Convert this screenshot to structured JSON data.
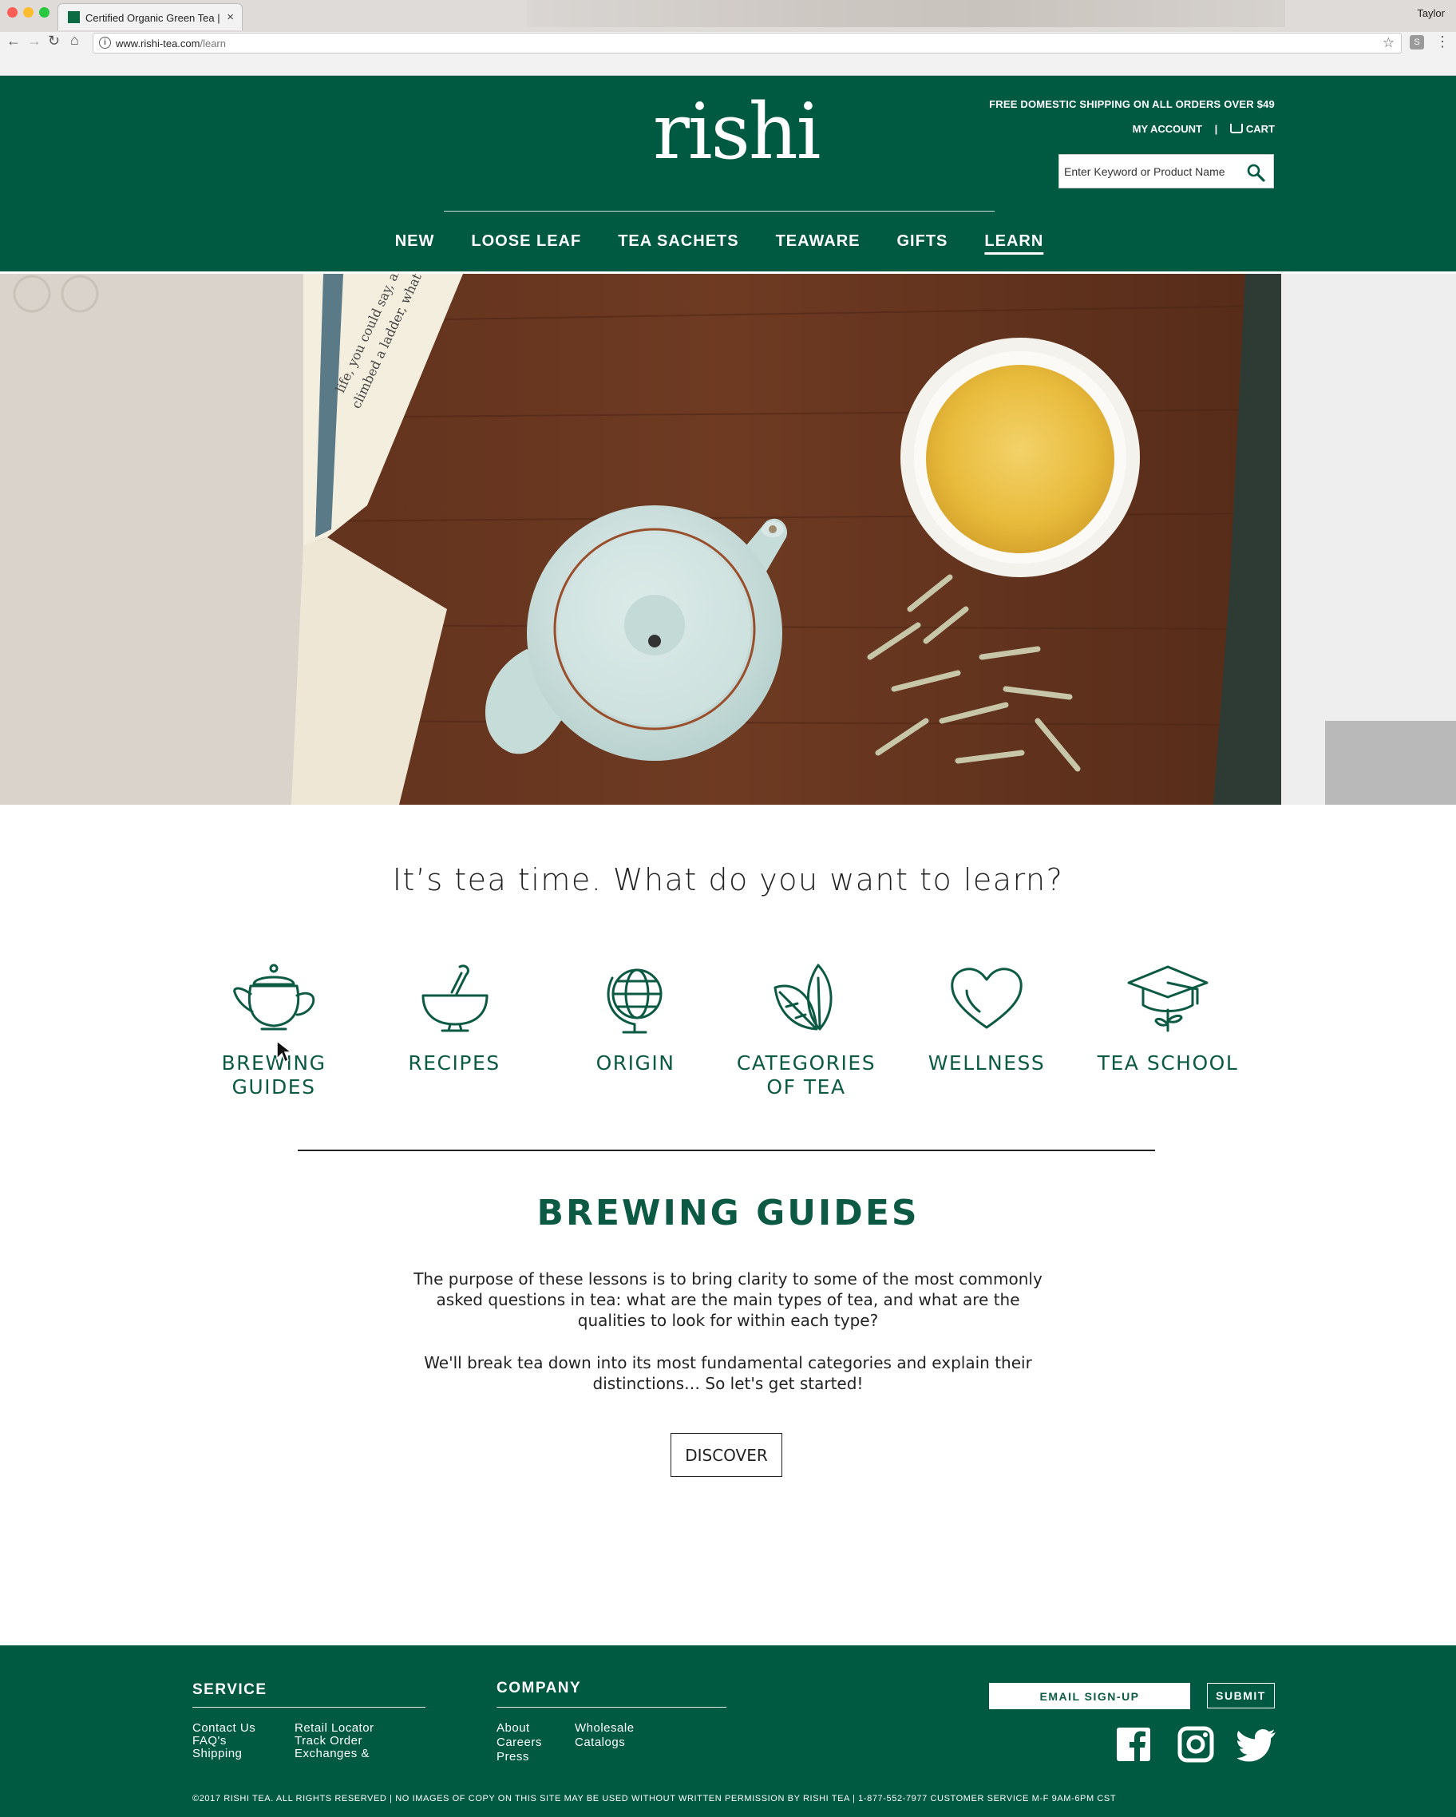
{
  "browser": {
    "tab_title": "Certified Organic Green Tea |",
    "tab_close": "×",
    "user": "Taylor",
    "url_host": "www.rishi-tea.com",
    "url_path": "/learn",
    "info_glyph": "i",
    "star_glyph": "☆",
    "ext_glyph": "S",
    "back_glyph": "←",
    "forward_glyph": "→",
    "reload_glyph": "↻",
    "home_glyph": "⌂",
    "menu_glyph": "⋮"
  },
  "header": {
    "logo": "rishi",
    "promo": "FREE DOMESTIC SHIPPING ON ALL ORDERS OVER $49",
    "my_account": "MY ACCOUNT",
    "separator": "|",
    "cart": "CART",
    "search_placeholder": "Enter Keyword or Product Name",
    "nav": [
      {
        "label": "NEW"
      },
      {
        "label": "LOOSE LEAF"
      },
      {
        "label": "TEA SACHETS"
      },
      {
        "label": "TEAWARE"
      },
      {
        "label": "GIFTS"
      },
      {
        "label": "LEARN",
        "active": true
      }
    ]
  },
  "learn": {
    "headline": "It’s tea time. What do you want to learn?",
    "topics": [
      {
        "label": "BREWING GUIDES",
        "icon": "teapot-icon"
      },
      {
        "label": "RECIPES",
        "icon": "mortar-pestle-icon"
      },
      {
        "label": "ORIGIN",
        "icon": "globe-icon"
      },
      {
        "label": "CATEGORIES OF TEA",
        "icon": "tea-leaves-icon"
      },
      {
        "label": "WELLNESS",
        "icon": "heart-icon"
      },
      {
        "label": "TEA SCHOOL",
        "icon": "graduation-cap-icon"
      }
    ],
    "section_title": "BREWING GUIDES",
    "paragraph_1": "The purpose of these lessons is to bring clarity to some of the most commonly asked questions in tea: what are the main types of tea, and what are the qualities to look for within each type?",
    "paragraph_2": "We'll break tea down into its most fundamental categories and explain their distinctions… So let's get started!",
    "discover_label": "DISCOVER"
  },
  "footer": {
    "service_title": "SERVICE",
    "service_links": [
      "Contact Us",
      "FAQ's",
      "Shipping",
      "Retail Locator",
      "Track Order",
      "Exchanges &"
    ],
    "company_title": "COMPANY",
    "company_links": [
      "About",
      "Careers",
      "Press",
      "Wholesale",
      "Catalogs"
    ],
    "email_placeholder": "EMAIL SIGN-UP",
    "submit_label": "SUBMIT",
    "social": [
      "facebook-icon",
      "instagram-icon",
      "twitter-icon"
    ],
    "copyright": "©2017 RISHI TEA. ALL RIGHTS RESERVED  |  NO IMAGES OF COPY ON THIS SITE MAY BE USED WITHOUT WRITTEN PERMISSION BY RISHI TEA  |  1-877-552-7977 CUSTOMER SERVICE M-F 9AM-6PM CST"
  },
  "colors": {
    "brand_green": "#005941",
    "text_green": "#0c5a43"
  }
}
